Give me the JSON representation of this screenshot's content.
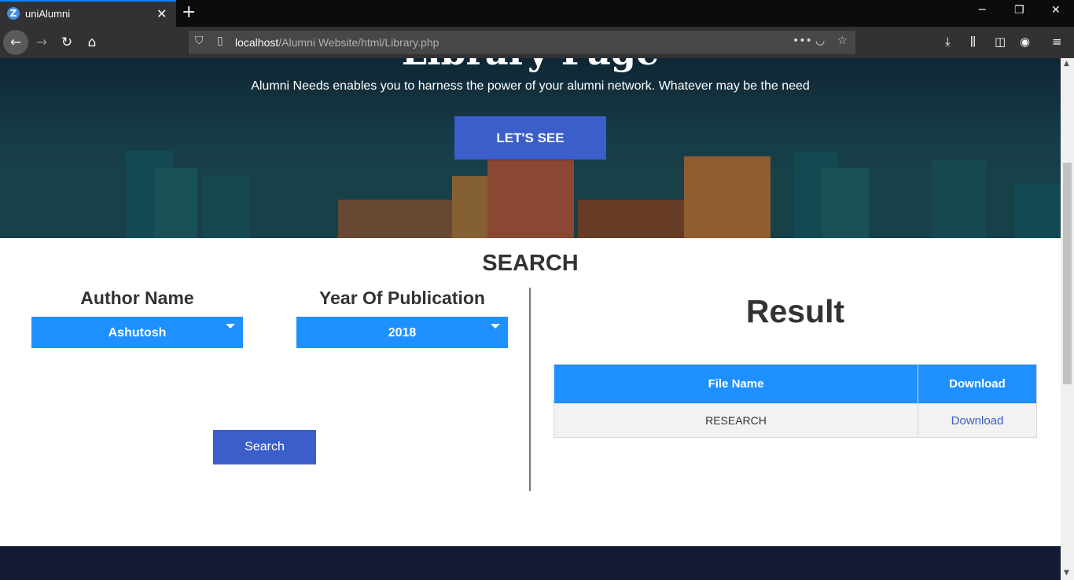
{
  "browser": {
    "tab_title": "uniAlumni",
    "tab_favicon_letter": "Z",
    "url_host": "localhost",
    "url_path": "/Alumni Website/html/Library.php"
  },
  "hero": {
    "title": "Library Page",
    "subtitle": "Alumni Needs enables you to harness the power of your alumni network. Whatever may be the need",
    "button_label": "LET'S SEE"
  },
  "search": {
    "heading": "SEARCH",
    "author_label": "Author Name",
    "author_selected": "Ashutosh",
    "year_label": "Year Of Publication",
    "year_selected": "2018",
    "button_label": "Search"
  },
  "result": {
    "title": "Result",
    "columns": [
      "File Name",
      "Download"
    ],
    "rows": [
      {
        "file_name": "RESEARCH",
        "download": "Download"
      }
    ]
  },
  "colors": {
    "accent_blue": "#1e90ff",
    "button_blue": "#3b5ecb",
    "footer": "#141a33"
  }
}
